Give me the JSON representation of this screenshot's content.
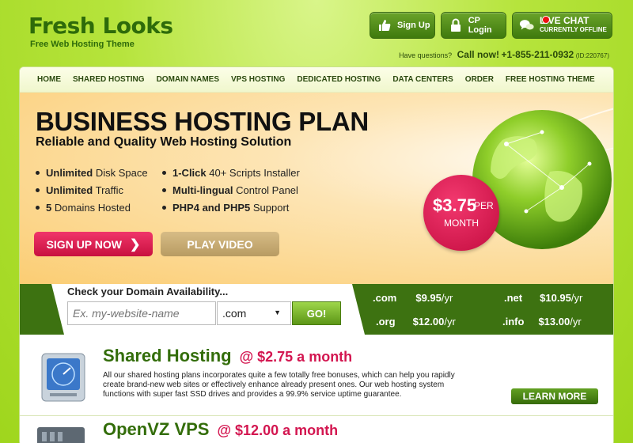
{
  "header": {
    "logo_title": "Fresh Looks",
    "logo_subtitle": "Free Web Hosting Theme",
    "signup_label": "Sign Up",
    "cplogin_label": "CP Login",
    "livechat_label": "LIVE CHAT",
    "livechat_status": "CURRENTLY OFFLINE",
    "questions_label": "Have questions?",
    "call_label": "Call now!",
    "phone": "+1-855-211-0932",
    "contact_id": "(ID:220767)"
  },
  "nav": {
    "items": [
      "HOME",
      "SHARED HOSTING",
      "DOMAIN NAMES",
      "VPS HOSTING",
      "DEDICATED HOSTING",
      "DATA CENTERS",
      "ORDER",
      "FREE HOSTING THEME"
    ]
  },
  "hero": {
    "title": "BUSINESS HOSTING PLAN",
    "subtitle": "Reliable and Quality Web Hosting Solution",
    "features": [
      {
        "bold": "Unlimited",
        "rest": " Disk Space"
      },
      {
        "bold": "Unlimited",
        "rest": " Traffic"
      },
      {
        "bold": "5",
        "rest": " Domains Hosted"
      },
      {
        "bold": "1-Click",
        "rest": " 40+ Scripts Installer"
      },
      {
        "bold": "Multi-lingual",
        "rest": " Control Panel"
      },
      {
        "bold": "PHP4 and PHP5",
        "rest": " Support"
      }
    ],
    "signup_label": "SIGN UP NOW",
    "play_label": "PLAY VIDEO",
    "price": "$3.75",
    "price_per": "PER",
    "price_period": "MONTH"
  },
  "domain": {
    "label": "Check your Domain Availability...",
    "input_placeholder": "Ex. my-website-name",
    "selected_tld": ".com",
    "go_label": "GO!",
    "prices": [
      {
        "tld": ".com",
        "price": "$9.95",
        "unit": "/yr"
      },
      {
        "tld": ".net",
        "price": "$10.95",
        "unit": "/yr"
      },
      {
        "tld": ".org",
        "price": "$12.00",
        "unit": "/yr"
      },
      {
        "tld": ".info",
        "price": "$13.00",
        "unit": "/yr"
      }
    ]
  },
  "products": [
    {
      "name": "Shared Hosting",
      "price": "@  $2.75  a month",
      "description": "All our shared hosting plans incorporates quite a few totally free bonuses, which can help you rapidly create brand-new web sites or effectively enhance already present ones. Our web hosting system functions with super fast SSD drives and provides a 99.9% service uptime guarantee.",
      "button": "LEARN MORE"
    },
    {
      "name": "OpenVZ VPS",
      "price": "@  $12.00  a month"
    }
  ],
  "colors": {
    "brand_green": "#336d0a",
    "accent_pink": "#d31650",
    "domain_bar": "#3d7211"
  }
}
